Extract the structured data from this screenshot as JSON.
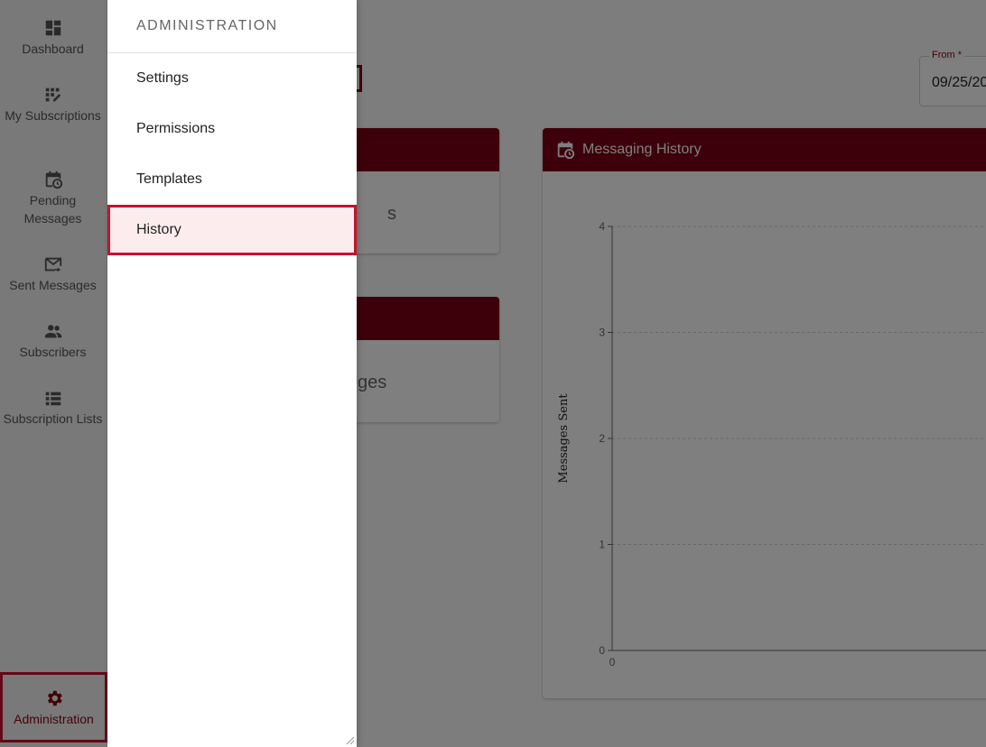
{
  "nav": {
    "items": [
      {
        "label": "Dashboard",
        "icon": "dashboard-icon"
      },
      {
        "label": "My Subscriptions",
        "icon": "subscriptions-icon"
      },
      {
        "label": "Pending Messages",
        "icon": "calendar-clock-icon"
      },
      {
        "label": "Sent Messages",
        "icon": "mail-sent-icon"
      },
      {
        "label": "Subscribers",
        "icon": "people-icon"
      },
      {
        "label": "Subscription Lists",
        "icon": "list-icon"
      }
    ],
    "admin": {
      "label": "Administration",
      "icon": "gear-icon"
    }
  },
  "drawer": {
    "title": "ADMINISTRATION",
    "items": [
      {
        "label": "Settings"
      },
      {
        "label": "Permissions"
      },
      {
        "label": "Templates"
      },
      {
        "label": "History",
        "active": true
      }
    ]
  },
  "filters": {
    "from_label": "From *",
    "from_value": "09/25/20"
  },
  "cards": {
    "card1_text": "s",
    "card2_text": "ges"
  },
  "chart": {
    "header": "Messaging History"
  },
  "chart_data": {
    "type": "bar",
    "title": "",
    "xlabel": "",
    "ylabel": "Messages Sent",
    "ylim": [
      0,
      4
    ],
    "yticks": [
      "0",
      "1",
      "2",
      "3",
      "4"
    ],
    "xticks": [
      "0"
    ],
    "grid": true,
    "categories": [],
    "values": []
  },
  "colors": {
    "brand": "#7a0017",
    "highlight": "#c8102e"
  }
}
